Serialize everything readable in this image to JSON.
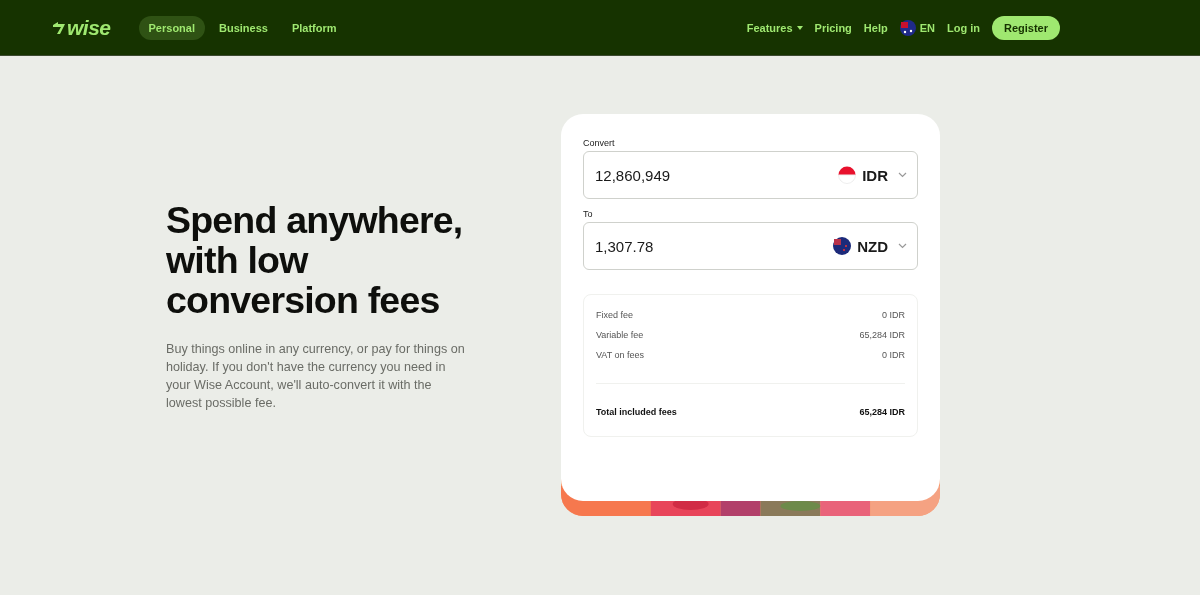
{
  "header": {
    "logo": "wise",
    "nav": [
      {
        "label": "Personal",
        "selected": true
      },
      {
        "label": "Business",
        "selected": false
      },
      {
        "label": "Platform",
        "selected": false
      }
    ],
    "links": [
      {
        "label": "Features",
        "kind": "dropdown"
      },
      {
        "label": "Pricing",
        "kind": "link"
      },
      {
        "label": "Help",
        "kind": "link"
      },
      {
        "label": "EN",
        "kind": "language"
      },
      {
        "label": "Log in",
        "kind": "link"
      }
    ],
    "register": "Register"
  },
  "hero": {
    "title": "Spend anywhere, with low conversion fees",
    "text": "Buy things online in any currency, or pay for things on holiday. If you don't have the currency you need in your Wise Account, we'll auto-convert it with the lowest possible fee."
  },
  "converter": {
    "fields": [
      {
        "label": "Convert",
        "value": "12,860,949",
        "currency": "IDR",
        "kind": "idr"
      },
      {
        "label": "To",
        "value": "1,307.78",
        "currency": "NZD",
        "kind": "nzd"
      }
    ],
    "fees": [
      {
        "label": "Fixed fee",
        "value": "0 IDR",
        "kind": "fee"
      },
      {
        "label": "Variable fee",
        "value": "65,284 IDR",
        "kind": "fee"
      },
      {
        "label": "VAT on fees",
        "value": "0 IDR",
        "kind": "fee"
      },
      {
        "label": "Total included fees",
        "value": "65,284 IDR",
        "kind": "total"
      }
    ]
  }
}
